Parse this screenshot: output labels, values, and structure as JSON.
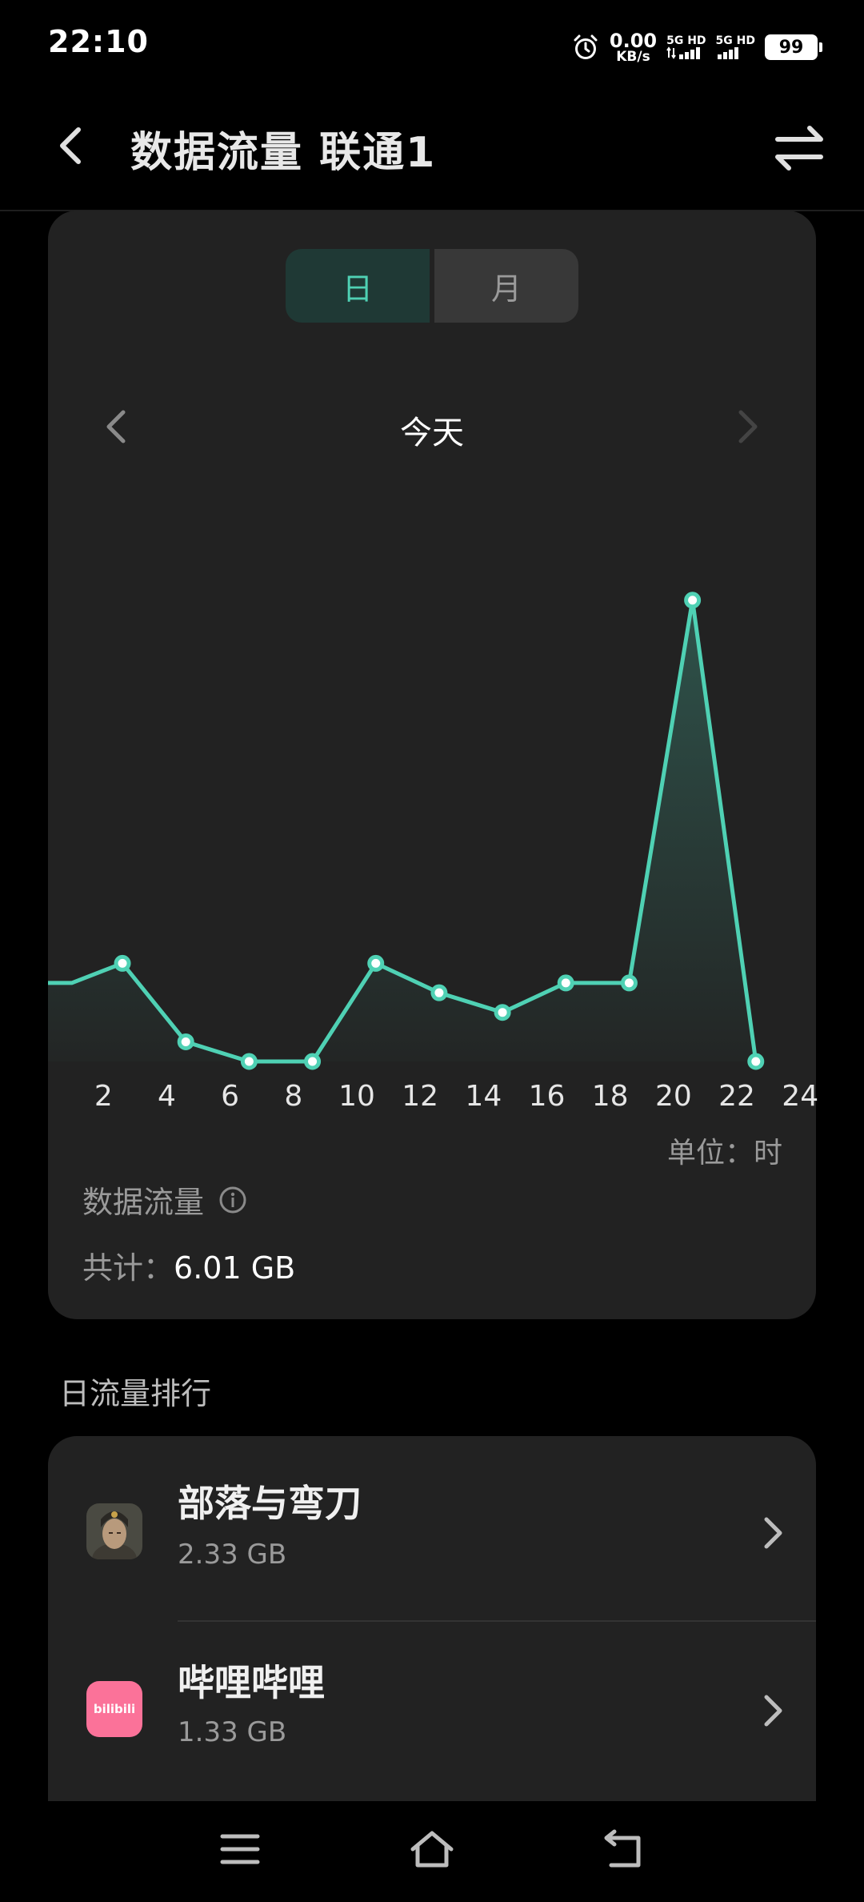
{
  "status": {
    "time": "22:10",
    "net_speed_value": "0.00",
    "net_speed_unit": "KB/s",
    "sim1_label": "5G HD",
    "sim2_label": "5G HD",
    "battery": "99"
  },
  "header": {
    "title": "数据流量 联通1"
  },
  "tabs": {
    "day": "日",
    "month": "月"
  },
  "period_label": "今天",
  "chart_data": {
    "type": "area",
    "x_tick_labels": [
      "2",
      "4",
      "6",
      "8",
      "10",
      "12",
      "14",
      "16",
      "18",
      "20",
      "22",
      "24"
    ],
    "x_ticks": [
      2,
      4,
      6,
      8,
      10,
      12,
      14,
      16,
      18,
      20,
      22,
      24
    ],
    "series": [
      {
        "x": [
          1,
          2.6,
          4.6,
          6.6,
          8.6,
          10.6,
          12.6,
          14.6,
          16.6,
          18.6,
          20.6,
          22.6
        ],
        "values": [
          0.16,
          0.2,
          0.04,
          0.0,
          0.0,
          0.2,
          0.14,
          0.1,
          0.16,
          0.16,
          0.94,
          0.0
        ],
        "color": "#4fd1b4"
      }
    ],
    "xlim": [
      0.25,
      24.5
    ],
    "ylim": [
      0,
      1
    ],
    "unit_label": "单位：时",
    "grid": false
  },
  "summary": {
    "title": "数据流量",
    "total_label": "共计：",
    "total_value": "6.01 GB"
  },
  "ranking": {
    "title": "日流量排行",
    "apps": [
      {
        "name": "部落与弯刀",
        "usage": "2.33 GB",
        "icon": "game-portrait-icon"
      },
      {
        "name": "哔哩哔哩",
        "usage": "1.33 GB",
        "icon": "bilibili-icon",
        "icon_text": "bilibili"
      }
    ]
  },
  "colors": {
    "accent": "#4fd1b4",
    "card": "#222222",
    "background": "#000000",
    "bilibili": "#fb7299"
  }
}
